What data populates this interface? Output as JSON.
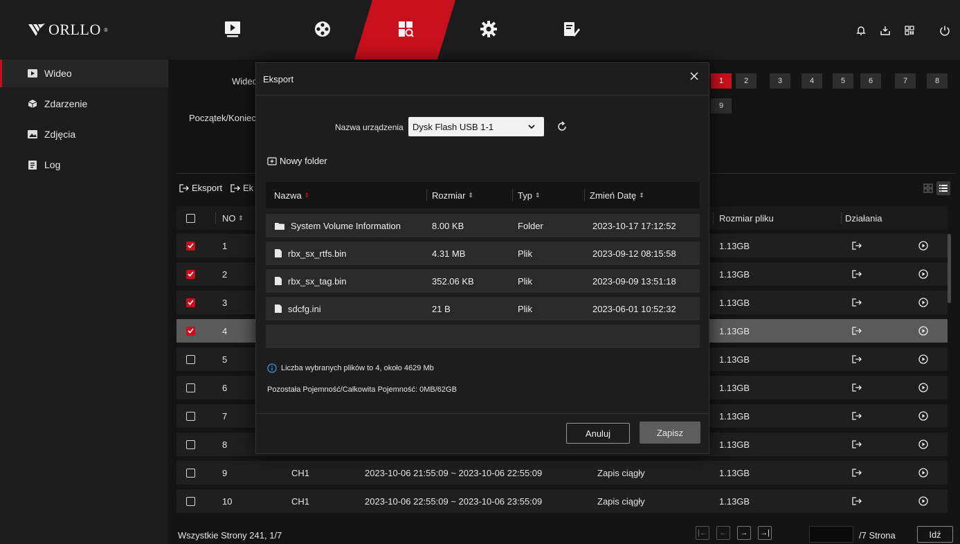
{
  "brand": {
    "name": "ORLLO",
    "reg": "®"
  },
  "sidebar": {
    "items": [
      {
        "label": "Wideo",
        "icon": "video-icon",
        "active": true
      },
      {
        "label": "Zdarzenie",
        "icon": "cube-icon"
      },
      {
        "label": "Zdjęcia",
        "icon": "image-icon"
      },
      {
        "label": "Log",
        "icon": "log-icon"
      }
    ]
  },
  "filters": {
    "video_label": "Wideo",
    "start_end_label": "Początek/Koniec",
    "channels": [
      "1",
      "2",
      "3",
      "4",
      "5",
      "6",
      "7",
      "8",
      "9"
    ]
  },
  "toolbar": {
    "export_label": "Eksport",
    "export2_label": "Ek"
  },
  "table": {
    "headers": {
      "no": "NO",
      "size": "Rozmiar pliku",
      "actions": "Działania"
    },
    "rows": [
      {
        "no": "1",
        "checked": true,
        "size": "1.13GB"
      },
      {
        "no": "2",
        "checked": true,
        "size": "1.13GB"
      },
      {
        "no": "3",
        "checked": true,
        "size": "1.13GB"
      },
      {
        "no": "4",
        "checked": true,
        "size": "1.13GB",
        "selected": true
      },
      {
        "no": "5",
        "checked": false,
        "size": "1.13GB"
      },
      {
        "no": "6",
        "checked": false,
        "size": "1.13GB"
      },
      {
        "no": "7",
        "checked": false,
        "size": "1.13GB"
      },
      {
        "no": "8",
        "checked": false,
        "size": "1.13GB"
      },
      {
        "no": "9",
        "checked": false,
        "channel": "CH1",
        "time": "2023-10-06 21:55:09 ~ 2023-10-06 22:55:09",
        "type": "Zapis ciągły",
        "size": "1.13GB"
      },
      {
        "no": "10",
        "checked": false,
        "channel": "CH1",
        "time": "2023-10-06 22:55:09 ~ 2023-10-06 23:55:09",
        "type": "Zapis ciągły",
        "size": "1.13GB"
      }
    ]
  },
  "pagination": {
    "summary": "Wszystkie Strony 241, 1/7",
    "page_suffix": "/7 Strona",
    "go_label": "Idź"
  },
  "modal": {
    "title": "Eksport",
    "device_label": "Nazwa urządzenia",
    "device_value": "Dysk Flash USB 1-1",
    "new_folder_label": "Nowy folder",
    "columns": {
      "name": "Nazwa",
      "size": "Rozmiar",
      "type": "Typ",
      "date": "Zmień Datę"
    },
    "files": [
      {
        "name": "System Volume Information",
        "size": "8.00 KB",
        "type": "Folder",
        "date": "2023-10-17 17:12:52",
        "icon": "folder-icon"
      },
      {
        "name": "rbx_sx_rtfs.bin",
        "size": "4.31 MB",
        "type": "Plik",
        "date": "2023-09-12 08:15:58",
        "icon": "file-icon"
      },
      {
        "name": "rbx_sx_tag.bin",
        "size": "352.06 KB",
        "type": "Plik",
        "date": "2023-09-09 13:51:18",
        "icon": "file-icon"
      },
      {
        "name": "sdcfg.ini",
        "size": "21 B",
        "type": "Plik",
        "date": "2023-06-01 10:52:32",
        "icon": "file-icon"
      }
    ],
    "info_text": "Liczba wybranych plików to 4, około 4629 Mb",
    "capacity_text": "Pozostała Pojemność/Całkowita Pojemność: 0MB/62GB",
    "cancel_label": "Anuluj",
    "save_label": "Zapisz"
  },
  "colors": {
    "accent": "#c8101c",
    "bg": "#141414",
    "panel": "#1c1c1c"
  }
}
